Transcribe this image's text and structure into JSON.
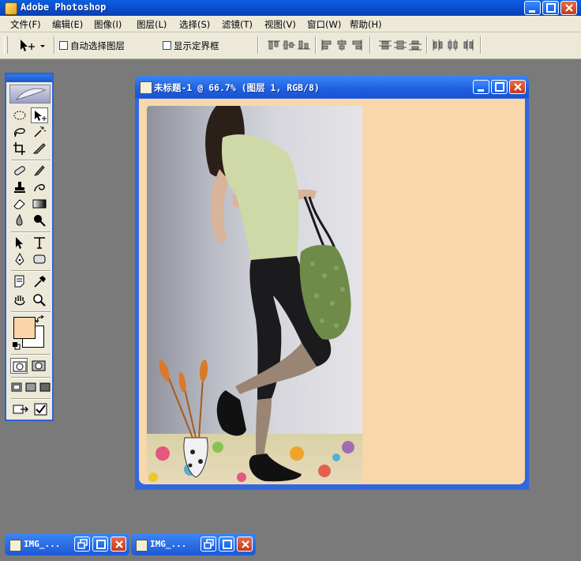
{
  "app": {
    "title": "Adobe Photoshop"
  },
  "menu": [
    "文件(F)",
    "编辑(E)",
    "图像(I)",
    "图层(L)",
    "选择(S)",
    "滤镜(T)",
    "视图(V)",
    "窗口(W)",
    "帮助(H)"
  ],
  "options": {
    "auto_select_label": "自动选择图层",
    "show_bounds_label": "显示定界框"
  },
  "document": {
    "title": "未标题-1 @ 66.7% (图层 1, RGB/8)"
  },
  "minimized": [
    {
      "label": "IMG_..."
    },
    {
      "label": "IMG_..."
    }
  ],
  "colors": {
    "foreground": "#f9d5a7",
    "background": "#ffffff",
    "canvas": "#f8d7ab",
    "titlebar": "#0b4fd0"
  }
}
